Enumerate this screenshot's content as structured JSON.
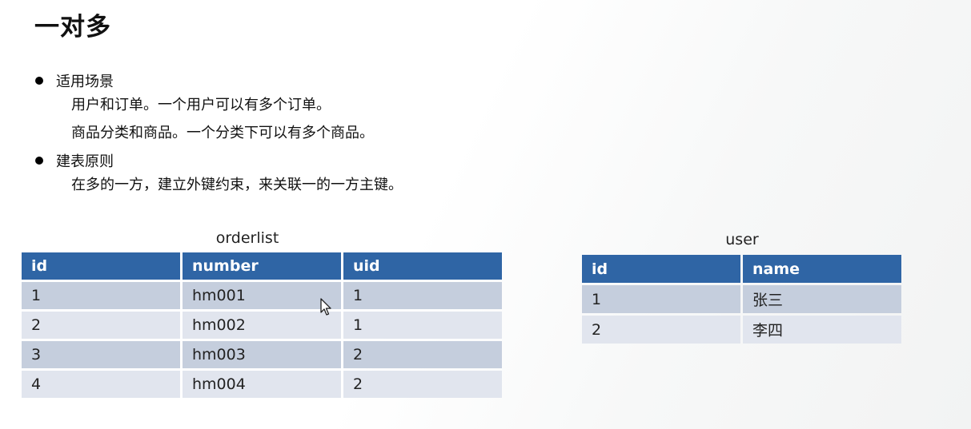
{
  "page": {
    "title": "一对多"
  },
  "bullets": [
    {
      "heading": "适用场景",
      "lines": [
        "用户和订单。一个用户可以有多个订单。",
        "商品分类和商品。一个分类下可以有多个商品。"
      ]
    },
    {
      "heading": "建表原则",
      "lines": [
        "在多的一方，建立外键约束，来关联一的一方主键。"
      ]
    }
  ],
  "tables": {
    "orderlist": {
      "caption": "orderlist",
      "columns": [
        "id",
        "number",
        "uid"
      ],
      "rows": [
        [
          "1",
          "hm001",
          "1"
        ],
        [
          "2",
          "hm002",
          "1"
        ],
        [
          "3",
          "hm003",
          "2"
        ],
        [
          "4",
          "hm004",
          "2"
        ]
      ]
    },
    "user": {
      "caption": "user",
      "columns": [
        "id",
        "name"
      ],
      "rows": [
        [
          "1",
          "张三"
        ],
        [
          "2",
          "李四"
        ]
      ]
    }
  },
  "colors": {
    "header_bg": "#2f65a5",
    "row_odd_bg": "#c5cedd",
    "row_even_bg": "#e1e5ee"
  },
  "icons": {
    "cursor": "mouse-pointer-icon",
    "bullet": "bullet-dot-icon"
  }
}
